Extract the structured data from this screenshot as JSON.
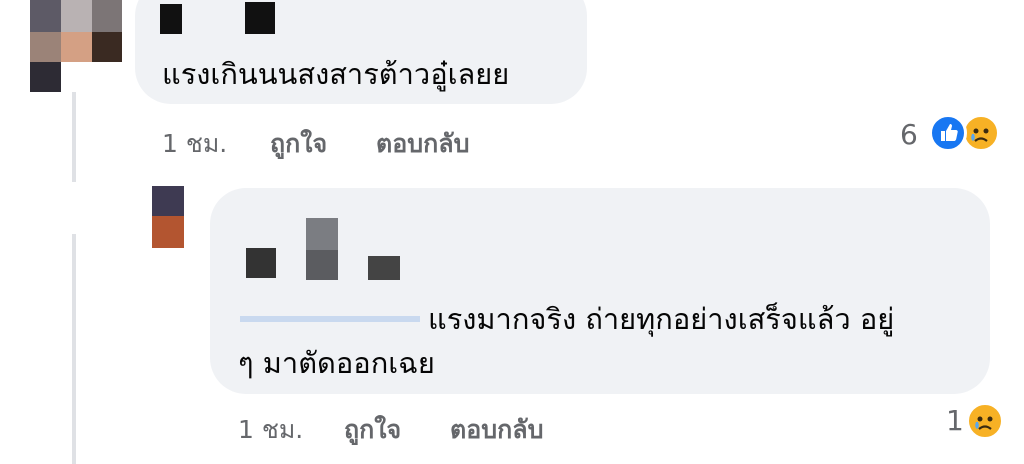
{
  "comments": [
    {
      "text": "แรงเกินนนสงสารต้าวอู๋เลยย",
      "time": "1 ชม.",
      "like_label": "ถูกใจ",
      "reply_label": "ตอบกลับ",
      "reaction_count": "6",
      "reactions": [
        "like-icon",
        "sad-icon"
      ]
    },
    {
      "text_line1": "แรงมากจริง ถ่ายทุกอย่างเสร็จแล้ว อยู่",
      "text_line2": "ๆ มาตัดออกเฉย",
      "time": "1 ชม.",
      "like_label": "ถูกใจ",
      "reply_label": "ตอบกลับ",
      "reaction_count": "1",
      "reactions": [
        "sad-icon"
      ]
    }
  ],
  "colors": {
    "bubble": "#f0f2f5",
    "meta_text": "#65676b",
    "like_blue": "#1877f2",
    "sad_yellow": "#f7b125"
  }
}
